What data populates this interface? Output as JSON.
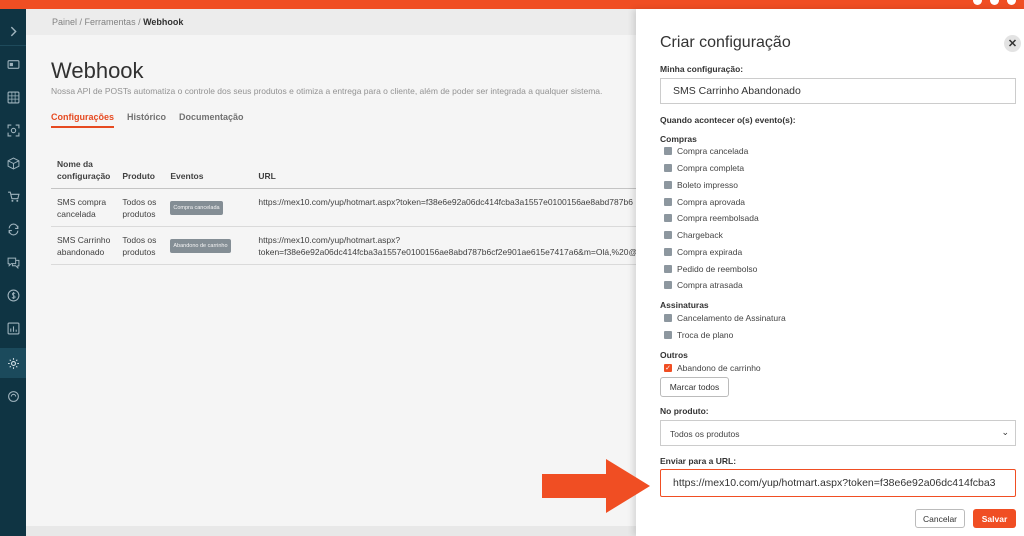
{
  "breadcrumb": {
    "item1": "Painel",
    "sep1": " / ",
    "item2": "Ferramentas",
    "sep2": " / ",
    "current": "Webhook"
  },
  "page": {
    "title": "Webhook",
    "description": "Nossa API de POSTs automatiza o controle dos seus produtos e otimiza a entrega para o cliente, além de poder ser integrada a qualquer sistema.",
    "tabs": [
      "Configurações",
      "Histórico",
      "Documentação"
    ]
  },
  "table": {
    "headers": [
      "Nome da configuração",
      "Produto",
      "Eventos",
      "URL"
    ],
    "rows": [
      {
        "name_line1": "SMS compra",
        "name_line2": "cancelada",
        "product_line1": "Todos os",
        "product_line2": "produtos",
        "event": "Compra cancelada",
        "url_line1": "https://mex10.com/yup/hotmart.aspx?token=f38e6e92a06dc414fcba3a1557e0100156ae8abd787b6",
        "url_line2": ""
      },
      {
        "name_line1": "SMS Carrinho",
        "name_line2": "abandonado",
        "product_line1": "Todos os",
        "product_line2": "produtos",
        "event": "Abandono de carrinho",
        "url_line1": "https://mex10.com/yup/hotmart.aspx?",
        "url_line2": "token=f38e6e92a06dc414fcba3a1557e0100156ae8abd787b6cf2e901ae615e7417a6&m=Olá,%20@n"
      }
    ]
  },
  "panel": {
    "title": "Criar configuração",
    "close": "✕",
    "config_label": "Minha configuração:",
    "config_value": "SMS Carrinho Abandonado",
    "events_label": "Quando acontecer o(s) evento(s):",
    "groups": {
      "compras": {
        "title": "Compras",
        "items": [
          "Compra cancelada",
          "Compra completa",
          "Boleto impresso",
          "Compra aprovada",
          "Compra reembolsada",
          "Chargeback",
          "Compra expirada",
          "Pedido de reembolso",
          "Compra atrasada"
        ]
      },
      "assinaturas": {
        "title": "Assinaturas",
        "items": [
          "Cancelamento de Assinatura",
          "Troca de plano"
        ]
      },
      "outros": {
        "title": "Outros",
        "items": [
          "Abandono de carrinho"
        ]
      }
    },
    "mark_all": "Marcar todos",
    "product_label": "No produto:",
    "product_value": "Todos os produtos",
    "url_label": "Enviar para a URL:",
    "url_value": "https://mex10.com/yup/hotmart.aspx?token=f38e6e92a06dc414fcba3",
    "cancel": "Cancelar",
    "save": "Salvar"
  },
  "colors": {
    "accent": "#f04e23",
    "sidebar": "#0f3443"
  },
  "icons": [
    "chevron-right-icon",
    "id-card-icon",
    "grid-icon",
    "scan-icon",
    "box-icon",
    "cart-icon",
    "refresh-icon",
    "chat-icon",
    "dollar-icon",
    "chart-icon",
    "gear-icon",
    "sync-icon",
    "arrow-icon"
  ]
}
